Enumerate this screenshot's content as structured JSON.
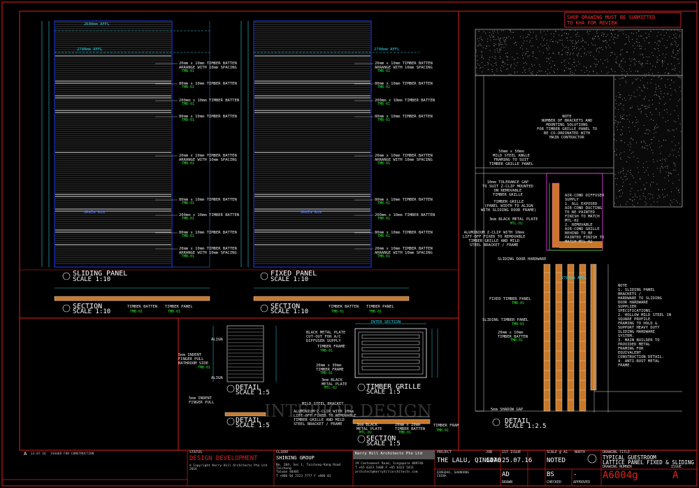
{
  "sheet": {
    "notice": "SHOP DRAWING MUST BE SUBMITTED\nTO KHA FOR REVIEW",
    "watermark": "INTERIOR DESIGN"
  },
  "sliding_elevation": {
    "dim_top": "2600mm AFFL",
    "dim_second": "2700mm AFFL",
    "labels": [
      {
        "text": "20mm x 10mm TIMBER BATTEN\nARRANGE WITH 10mm SPACING",
        "tag": "TMB-01"
      },
      {
        "text": "80mm x 10mm TIMBER BATTEN",
        "tag": "TMB-01"
      },
      {
        "text": "200mm x 10mm TIMBER BATTEN",
        "tag": "TMB-01"
      },
      {
        "text": "80mm x 10mm TIMBER BATTEN",
        "tag": "TMB-01"
      },
      {
        "text": "20mm x 10mm TIMBER BATTEN\nARRANGE WITH 10mm SPACING",
        "tag": "TMB-01"
      },
      {
        "text": "80mm x 10mm TIMBER BATTEN",
        "tag": "TMB-01"
      },
      {
        "text": "200mm x 10mm TIMBER BATTEN",
        "tag": "TMB-01"
      },
      {
        "text": "80mm x 10mm TIMBER BATTEN",
        "tag": "TMB-01"
      },
      {
        "text": "20mm x 10mm TIMBER BATTEN\nARRANGE WITH 10mm SPACING",
        "tag": "TMB-01"
      }
    ],
    "grain": "GRAIN RUN",
    "title": "SLIDING PANEL",
    "scale": "SCALE 1:10"
  },
  "fixed_elevation": {
    "dim_second": "2700mm AFFL",
    "labels": [
      {
        "text": "20mm x 10mm TIMBER BATTEN\nARRANGE WITH 10mm SPACING",
        "tag": "TMB-01"
      },
      {
        "text": "80mm x 10mm TIMBER BATTEN",
        "tag": "TMB-01"
      },
      {
        "text": "200mm x 10mm TIMBER BATTEN",
        "tag": "TMB-01"
      },
      {
        "text": "80mm x 10mm TIMBER BATTEN",
        "tag": "TMB-01"
      },
      {
        "text": "20mm x 10mm TIMBER BATTEN\nARRANGE WITH 10mm SPACING",
        "tag": "TMB-01"
      },
      {
        "text": "80mm x 10mm TIMBER BATTEN",
        "tag": "TMB-01"
      },
      {
        "text": "200mm x 10mm TIMBER BATTEN",
        "tag": "TMB-01"
      },
      {
        "text": "80mm x 10mm TIMBER BATTEN",
        "tag": "TMB-01"
      },
      {
        "text": "20mm x 10mm TIMBER BATTEN\nARRANGE WITH 10mm SPACING",
        "tag": "TMB-01"
      }
    ],
    "grain": "GRAIN RUN",
    "title": "FIXED PANEL",
    "scale": "SCALE 1:10"
  },
  "section_left": {
    "title": "SECTION",
    "scale": "SCALE 1:10",
    "batten": "TIMBER BATTEN",
    "batten_tag": "TMB-01",
    "panel": "TIMBER PANEL",
    "panel_tag": "TMB-01"
  },
  "section_right": {
    "title": "SECTION",
    "scale": "SCALE 1:10",
    "batten": "TIMBER BATTEN",
    "batten_tag": "TMB-01",
    "panel": "TIMBER PANEL",
    "panel_tag": "TMB-01"
  },
  "detail_finger": {
    "title": "DETAIL",
    "scale": "SCALE 1:5",
    "align": "ALIGN",
    "pull": "5mm INDENT\nFINGER PULL\nBATHROOM SIDE",
    "pull_tag": "TMB-01"
  },
  "detail_finger2": {
    "title": "DETAIL",
    "scale": "SCALE 1:5",
    "pull": "5mm INDENT\nFINGER PULL"
  },
  "grille": {
    "title": "TIMBER GRILLE",
    "scale": "SCALE 1:5",
    "plate": "BLACK METAL PLATE\nCUT-OUT FOR A/C\nDIFFUSER SUPPLY",
    "frame": "TIMBER FRAME",
    "frame_tag": "TMB-01",
    "batten1": "20mm x 30mm\nTIMBER FRAME",
    "batten1_tag": "TMB-01",
    "metal": "3mm BLACK\nMETAL PLATE",
    "metal_tag": "MTL-02",
    "section_label": "INTER SECTION"
  },
  "section_grille": {
    "title": "SECTION",
    "scale": "SCALE 1:5",
    "bracket": "MILD STEEL BRACKET",
    "zclip": "ALUMINIUM Z-CLIP WITH 10mm\nLIFT-OFF FIXED TO REMOVABLE\nTIMBER GRILLE AND MILD\nSTEEL BRACKET / FRAME",
    "plate": "3mm BLACK\nMETAL PLATE",
    "plate_tag": "MTL-02",
    "batten": "20mm x 20mm\nTIMBER BATTEN",
    "batten_tag": "TMB-01",
    "frame": "TIMBER FRAM",
    "frame_tag": "TMB-01"
  },
  "detail_large": {
    "title": "DETAIL",
    "scale": "SCALE 1:2.5",
    "note": "NOTE\nNUMBER OF BRACKETS AND\nMOUNTING SOLUTIONS\nFOR TIMBER GRILLE PANEL TO\nBE CO-ORDINATED WITH\nMAIN CONTRACTOR",
    "angle": "50mm x 50mm\nMILD STEEL ANGLE\nFRAMING TO SUIT\nTIMBER GRILLE PANEL",
    "gap": "10mm TOLERANCE GAP\nTO SUIT Z-CLIP MOUNTED\nON REMOVABLE\nTIMBER GRILLE",
    "grille_panel": "TIMBER GRILLE\n(PANEL WIDTH TO ALIGN\nWITH SLIDING DOOR FRAME)",
    "plate": "3mm BLACK METAL PLATE",
    "plate_tag": "MTL-02",
    "zclip": "ALUMINIUM Z-CLIP WITH 10mm\nLIFT-OFF FIXED TO REMOVABLE\nTIMBER GRILLE AND MILD\nSTEEL BRACKET / FRAME",
    "aircon": "AIR-COND DIFFUSER\nSUPPLY\n1. ALL EXPOSED\nAIR-COND DUCTING\nTO BE PAINTED\nFINISH TO MATCH\nMTL-02\n2. REMOVABLE\nAIR-COND GRILLE\nBEHIND TO BE\nPAINTED FINISH TO\nMATCH MTL-02",
    "hardware": "SLIDING DOOR HARDWARE",
    "affl": "2700mm AFFL",
    "fixed_timber": "FIXED TIMBER PANEL",
    "fixed_tag": "TMB-01",
    "sliding_timber": "SLIDING TIMBER PANEL",
    "sliding_tag": "TMB-01",
    "batten": "20mm x 10mm\nTIMBER BATTEN",
    "batten_tag": "TMB-01",
    "shadow": "5mm SHADOW GAP",
    "notes": "NOTE\n1. SLIDING PANEL\nBRACKETS /\nHARDWARE TO SLIDING\nDOOR HARDWARE\nSUPPLIER\nSPECIFICATIONS.\n2. HOLLOW MILD STEEL IN\nSQUARE PROFILE\nFRAMING TO HOLD &\nSUPPORT HEAVY DUTY\nSLIDING HARDWARE\nSYSTEM.\n3. MAIN BUILDER TO\nPROVIDED METAL\nFRAMING FOR\nEQUIVALENT\nCONSTRUCTION DETAIL.\n4. ANTI-RUST METAL\nFRAME."
  },
  "title_block": {
    "revision_a": "A",
    "revision_date": "13.07.16",
    "revision_text": "ISSUED FOR CONSTRUCTION",
    "status_label": "STATUS",
    "status": "DESIGN DEVELOPMENT",
    "copyright": "© Copyright Kerry Hill Architects Pte Ltd\n2016",
    "client_label": "CLIENT",
    "client": "SHINING GROUP",
    "client_addr": "No. 204, Sec 1, Taichung-Kang Road\nTaichung\nTaiwan 40405",
    "client_tel": "T +886 04 2323 7777    F +886 02",
    "architect": "Kerry Hill Architects Pte Ltd",
    "architect_addr": "29 Cantonment Road, Singapore 089746",
    "architect_tel": "T +65 6323 5400     F +65 6323 5411",
    "architect_mail": "architect@kerryhillarchitects.com",
    "project_label": "PROJECT",
    "project": "THE LALU, QINGDAO",
    "project_addr": "QINGDAO, SHANDONG\nCHINA",
    "job_label": "JOB",
    "job": "1476",
    "issue_label": "1ST ISSUE",
    "issue_date": "25.07.16",
    "scale_label": "SCALE @ A1",
    "scale": "NOTED",
    "north_label": "NORTH",
    "drawn_label": "DRAWN",
    "drawn": "AD",
    "checked_label": "CHECKED",
    "checked": "BS",
    "approved_label": "APPROVED",
    "approved": "-",
    "title_label": "DRAWING TITLE",
    "title": "TYPICAL GUESTROOM\nLATTICE PANEL FIXED & SLIDING",
    "number_label": "DRAWING NUMBER",
    "number": "A6004g",
    "issue_rev_label": "ISSUE",
    "issue_rev": "A"
  },
  "colors": {
    "background": "#000000",
    "frame_red": "#e02020",
    "frame_blue": "#2040ff",
    "annotation_green": "#2ee82e",
    "dimension_cyan": "#29d4e8",
    "timber_orange": "#c87828"
  }
}
